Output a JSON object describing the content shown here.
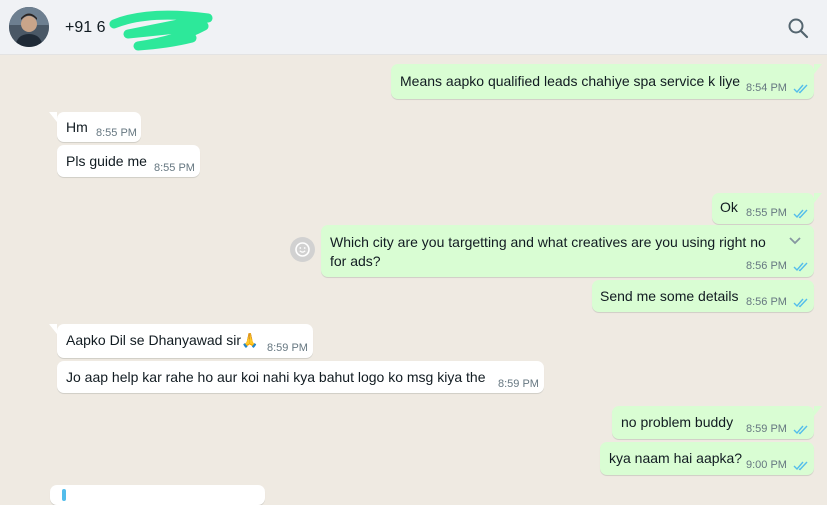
{
  "header": {
    "phone_prefix": "+91 6",
    "search_icon": "search-icon",
    "avatar_icon": "avatar"
  },
  "colors": {
    "incoming_bg": "#ffffff",
    "outgoing_bg": "#d9fdd3",
    "chat_bg": "#efeae2",
    "header_bg": "#f0f2f5",
    "tick_read": "#53bdeb",
    "redaction": "#2de89a"
  },
  "messages": [
    {
      "dir": "out",
      "text": "Means aapko qualified leads chahiye spa service k liye",
      "time": "8:54 PM",
      "ticks": "read"
    },
    {
      "dir": "in",
      "text": "Hm",
      "time": "8:55 PM"
    },
    {
      "dir": "in",
      "text": "Pls guide me",
      "time": "8:55 PM"
    },
    {
      "dir": "out",
      "text": "Ok",
      "time": "8:55 PM",
      "ticks": "read"
    },
    {
      "dir": "out",
      "text_line1": "Which city are you targetting and what creatives are you using right no",
      "text_line2": "for ads?",
      "time": "8:56 PM",
      "ticks": "read"
    },
    {
      "dir": "out",
      "text": "Send me some details",
      "time": "8:56 PM",
      "ticks": "read"
    },
    {
      "dir": "in",
      "text": "Aapko Dil se Dhanyawad sir🙏",
      "time": "8:59 PM"
    },
    {
      "dir": "in",
      "text": "Jo aap help kar rahe ho aur koi nahi kya bahut logo ko msg kiya the",
      "time": "8:59 PM"
    },
    {
      "dir": "out",
      "text": "no problem buddy",
      "time": "8:59 PM",
      "ticks": "read"
    },
    {
      "dir": "out",
      "text": "kya naam hai aapka?",
      "time": "9:00 PM",
      "ticks": "read"
    }
  ]
}
